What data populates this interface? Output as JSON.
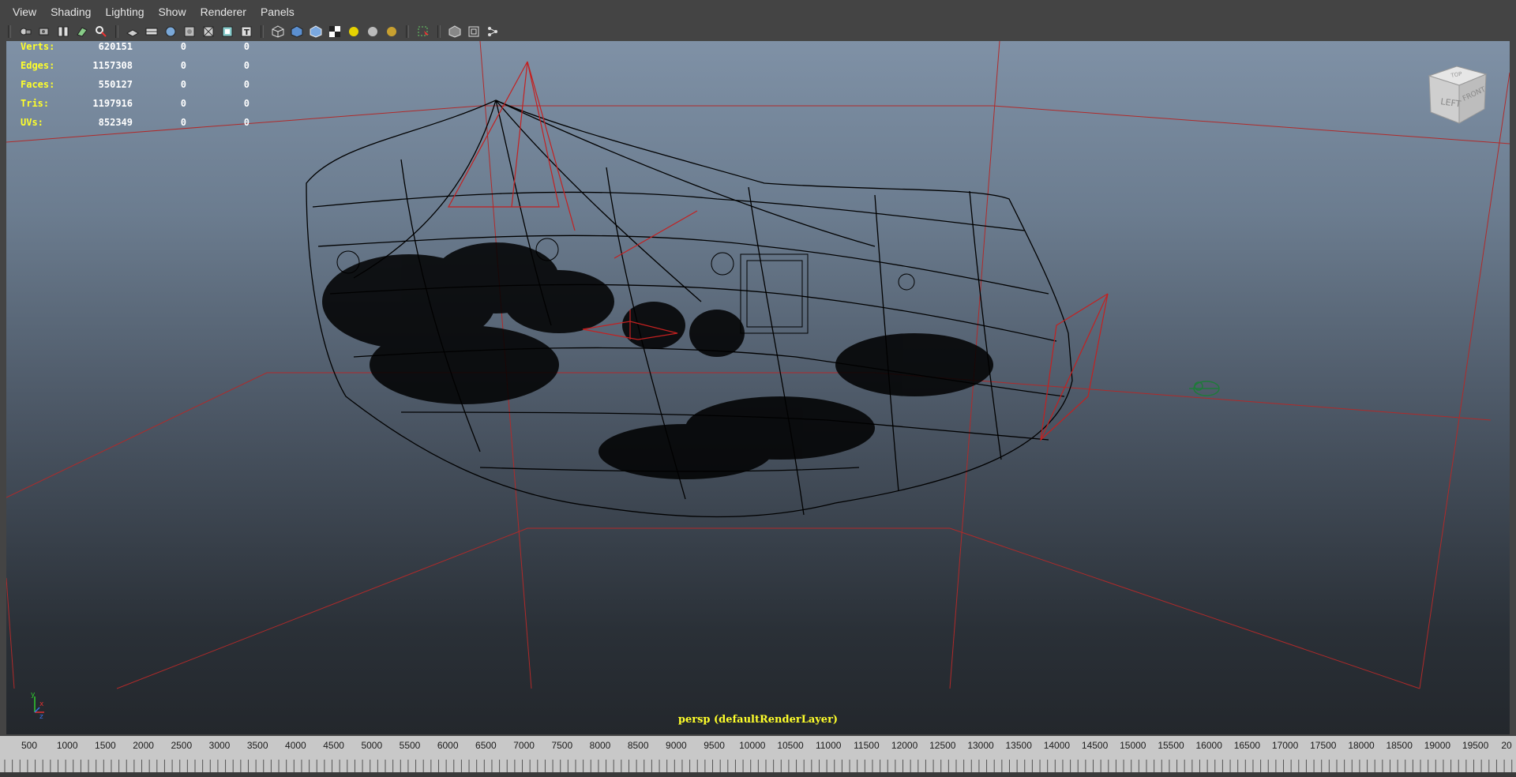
{
  "menubar": {
    "items": [
      "View",
      "Shading",
      "Lighting",
      "Show",
      "Renderer",
      "Panels"
    ]
  },
  "toolbar": {
    "icons": [
      "camera-select-icon",
      "camera-attributes-icon",
      "bookmarks-icon",
      "image-plane-icon",
      "2d-pan-zoom-icon",
      "grid-icon",
      "film-gate-icon",
      "resolution-gate-icon",
      "gate-mask-icon",
      "field-chart-icon",
      "safe-action-icon",
      "safe-title-icon",
      "wireframe-icon",
      "smooth-shade-icon",
      "shaded-wireframe-icon",
      "textured-icon",
      "default-light-icon",
      "all-lights-icon",
      "isolate-select-icon",
      "xray-icon",
      "xray-joints-icon",
      "xray-components-icon"
    ]
  },
  "hud": {
    "rows": [
      {
        "label": "Verts:",
        "total": "620151",
        "selected": "0",
        "components": "0"
      },
      {
        "label": "Edges:",
        "total": "1157308",
        "selected": "0",
        "components": "0"
      },
      {
        "label": "Faces:",
        "total": "550127",
        "selected": "0",
        "components": "0"
      },
      {
        "label": "Tris:",
        "total": "1197916",
        "selected": "0",
        "components": "0"
      },
      {
        "label": "UVs:",
        "total": "852349",
        "selected": "0",
        "components": "0"
      }
    ]
  },
  "viewport": {
    "camera_label": "persp (defaultRenderLayer)",
    "viewcube_faces": {
      "left": "LEFT",
      "front": "FRONT",
      "top": "TOP"
    },
    "axis_labels": {
      "y": "y",
      "x": "x",
      "z": "z"
    },
    "colors": {
      "wireframe": "#000000",
      "camera_lines": "#c42020",
      "selected_green": "#1f7a3a",
      "hud_label": "#ffff2a"
    }
  },
  "timeslider": {
    "ticks": [
      "500",
      "1000",
      "1500",
      "2000",
      "2500",
      "3000",
      "3500",
      "4000",
      "4500",
      "5000",
      "5500",
      "6000",
      "6500",
      "7000",
      "7500",
      "8000",
      "8500",
      "9000",
      "9500",
      "10000",
      "10500",
      "11000",
      "11500",
      "12000",
      "12500",
      "13000",
      "13500",
      "14000",
      "14500",
      "15000",
      "15500",
      "16000",
      "16500",
      "17000",
      "17500",
      "18000",
      "18500",
      "19000",
      "19500",
      "20"
    ]
  }
}
